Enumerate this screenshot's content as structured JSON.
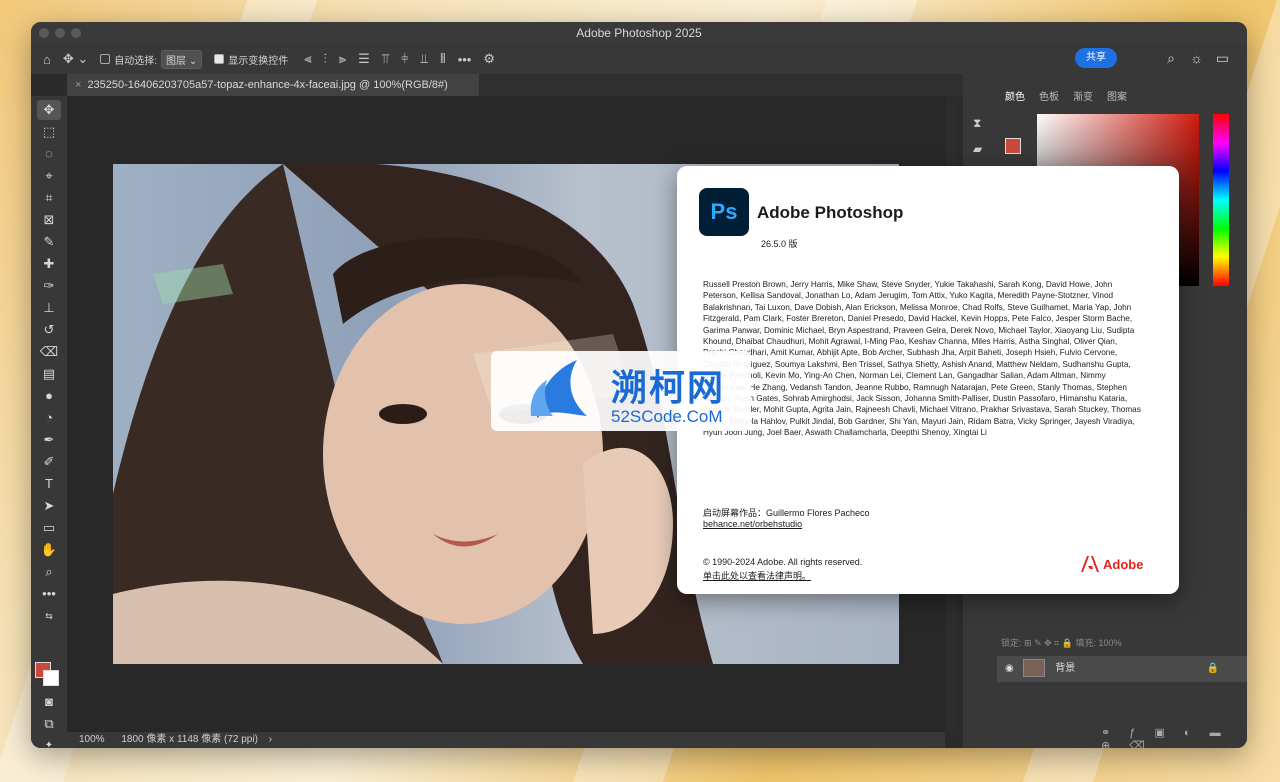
{
  "window": {
    "title": "Adobe Photoshop 2025"
  },
  "options_bar": {
    "auto_select_label": "自动选择:",
    "auto_select_target": "图层",
    "show_transform_label": "显示变换控件",
    "share_label": "共享"
  },
  "document": {
    "tab_title": "235250-16406203705a57-topaz-enhance-4x-faceai.jpg @ 100%(RGB/8#)"
  },
  "status_bar": {
    "zoom": "100%",
    "info": "1800 像素 x 1148 像素 (72 ppi)"
  },
  "right_panel": {
    "tabs": [
      "颜色",
      "色板",
      "渐变",
      "图案"
    ],
    "lock_label": "锁定:",
    "fill_label": "填充:",
    "fill_value": "100%",
    "layer_name": "背景"
  },
  "about": {
    "app_name": "Adobe Photoshop",
    "logo_text": "Ps",
    "version": "26.5.0 版",
    "credits": "Russell Preston Brown, Jerry Harris, Mike Shaw, Steve Snyder, Yukie Takahashi, Sarah Kong, David Howe, John Peterson, Kellisa Sandoval, Jonathan Lo, Adam Jerugim, Tom Attix, Yuko Kagita, Meredith Payne-Stotzner, Vinod Balakrishnan, Tai Luxon, Dave Dobish, Alan Erickson, Melissa Monroe, Chad Rolfs, Steve Guilhamet, Maria Yap, John Fitzgerald, Pam Clark, Foster Brereton, Daniel Presedo, David Hackel, Kevin Hopps, Pete Falco, Jesper Storm Bache, Garima Panwar, Dominic Michael, Bryn Aspestrand, Praveen Gelra, Derek Novo, Michael Taylor, Xiaoyang Liu, Sudipta Khound, Dhaibat Chaudhuri, Mohit Agrawal, I-Ming Pao, Keshav Channa, Miles Harris, Astha Singhal, Oliver Qian, Prachi Chaudhari, Amit Kumar, Abhijit Apte, Bob Archer, Subhash Jha, Arpit Baheti, Joseph Hsieh, Fulvio Cervone, Claudia Rodriguez, Soumya Lakshmi, Ben Trissel, Sathya Shetty, Ashish Anand, Matthew Neldam, Sudhanshu Gupta, Neerja Pancholi, Kevin Mo, Ying-An Chen, Norman Lei, Clement Lan, Gangadhar Salian, Adam Altman, Nimmy Sukumaran, He Zhang, Vedansh Tandon, Jeanne Rubbo, Ramnugh Natarajan, Pete Green, Stanly Thomas, Stephen Nielson, Ryan Gates, Sohrab Amirghodsi, Jack Sisson, Johanna Smith-Palliser, Dustin Passofaro, Himanshu Kataria, Andrew Sender, Mohit Gupta, Agrita Jain, Rajneesh Chavli, Michael Vitrano, Prakhar Srivastava, Sarah Stuckey, Thomas Ruark, Mihaela Hahlov, Pulkit Jindal, Bob Gardner, Shi Yan, Mayuri Jain, Ridam Batra, Vicky Springer, Jayesh Viradiya, Hyun Joon Jung, Joel Baer, Aswath Challamcharla, Deepthi Shenoy, Xingtai Li",
    "splash_label": "启动屏幕作品：Guillermo Flores Pacheco",
    "splash_link": "behance.net/orbehstudio",
    "copyright": "© 1990-2024 Adobe. All rights reserved.",
    "legal_link": "单击此处以查看法律声明。",
    "adobe_label": "Adobe"
  },
  "watermark": {
    "cn": "溯柯网",
    "en": "52SCode.CoM"
  },
  "colors": {
    "ps_blue": "#31a8ff",
    "ps_dark": "#001e36",
    "share_blue": "#1f6fe5",
    "foreground": "#c94a3c",
    "adobe_red": "#e1251b"
  }
}
